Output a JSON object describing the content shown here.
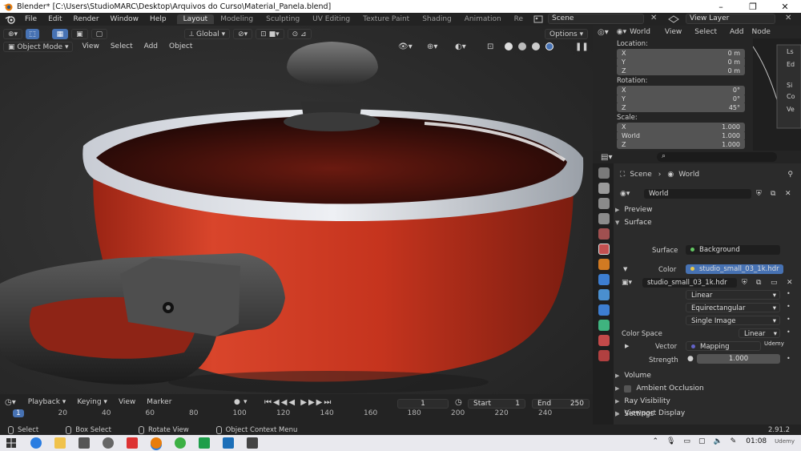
{
  "window": {
    "title": "Blender* [C:\\Users\\StudioMARC\\Desktop\\Arquivos do Curso\\Material_Panela.blend]",
    "minimize": "–",
    "maximize": "❐",
    "close": "✕"
  },
  "menu": [
    "File",
    "Edit",
    "Render",
    "Window",
    "Help"
  ],
  "workspaces": [
    "Layout",
    "Modeling",
    "Sculpting",
    "UV Editing",
    "Texture Paint",
    "Shading",
    "Animation",
    "Re"
  ],
  "scene": "Scene",
  "view_layer": "View Layer",
  "viewport": {
    "transform_orientation": "Global",
    "options": "Options",
    "mode": "Object Mode",
    "menus": [
      "View",
      "Select",
      "Add",
      "Object"
    ]
  },
  "node_header": {
    "world_label": "World",
    "menus": [
      "View",
      "Select",
      "Add",
      "Node"
    ],
    "side_tabs": [
      "Ls",
      "Ed",
      "Si",
      "Co",
      "Ve"
    ]
  },
  "transform": {
    "location_label": "Location:",
    "location": [
      {
        "axis": "X",
        "value": "0 m"
      },
      {
        "axis": "Y",
        "value": "0 m"
      },
      {
        "axis": "Z",
        "value": "0 m"
      }
    ],
    "rotation_label": "Rotation:",
    "rotation": [
      {
        "axis": "X",
        "value": "0°"
      },
      {
        "axis": "Y",
        "value": "0°"
      },
      {
        "axis": "Z",
        "value": "45°"
      }
    ],
    "scale_label": "Scale:",
    "scale": [
      {
        "axis": "X",
        "value": "1.000"
      },
      {
        "axis": "Y",
        "value": "1.000"
      },
      {
        "axis": "Z",
        "value": "1.000"
      }
    ],
    "node_label": "World"
  },
  "properties": {
    "breadcrumb_scene": "Scene",
    "breadcrumb_world": "World",
    "world_name": "World",
    "sections": {
      "preview": "Preview",
      "surface": "Surface",
      "volume": "Volume",
      "ao": "Ambient Occlusion",
      "ray_visibility": "Ray Visibility",
      "settings": "Settings",
      "viewport_display": "Viewport Display"
    },
    "surface_label": "Surface",
    "surface_value": "Background",
    "color_label": "Color",
    "color_value": "studio_small_03_1k.hdr",
    "image_name": "studio_small_03_1k.hdr",
    "interpolation": "Linear",
    "projection": "Equirectangular",
    "source": "Single Image",
    "color_space_label": "Color Space",
    "color_space_value": "Linear",
    "vector_label": "Vector",
    "vector_value": "Mapping",
    "strength_label": "Strength",
    "strength_value": "1.000",
    "watermark": "Udemy"
  },
  "timeline": {
    "menus": [
      "Playback",
      "Keying",
      "View",
      "Marker"
    ],
    "current_frame": "1",
    "start_label": "Start",
    "start": "1",
    "end_label": "End",
    "end": "250",
    "ticks": [
      "1",
      "20",
      "40",
      "60",
      "80",
      "100",
      "120",
      "140",
      "160",
      "180",
      "200",
      "220",
      "240"
    ]
  },
  "status": {
    "select": "Select",
    "box_select": "Box Select",
    "rotate_view": "Rotate View",
    "context_menu": "Object Context Menu",
    "version": "2.91.2"
  },
  "taskbar": {
    "time": "01:08",
    "udemy_mark": "Udemy"
  },
  "colors": {
    "accent_blue": "#4772b3",
    "pot_red": "#c8321c",
    "panel_bg": "#2b2b2b"
  }
}
